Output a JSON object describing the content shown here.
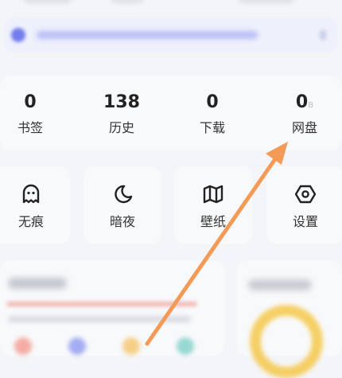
{
  "stats": [
    {
      "value": "0",
      "unit": "",
      "label": "书签"
    },
    {
      "value": "138",
      "unit": "",
      "label": "历史"
    },
    {
      "value": "0",
      "unit": "",
      "label": "下载"
    },
    {
      "value": "0",
      "unit": "B",
      "label": "网盘"
    }
  ],
  "tiles": [
    {
      "label": "无痕",
      "icon": "ghost-icon"
    },
    {
      "label": "暗夜",
      "icon": "moon-icon"
    },
    {
      "label": "壁纸",
      "icon": "map-icon"
    },
    {
      "label": "设置",
      "icon": "gear-icon"
    }
  ],
  "colors": {
    "arrow": "#f49a57",
    "accent": "#5561e8"
  }
}
